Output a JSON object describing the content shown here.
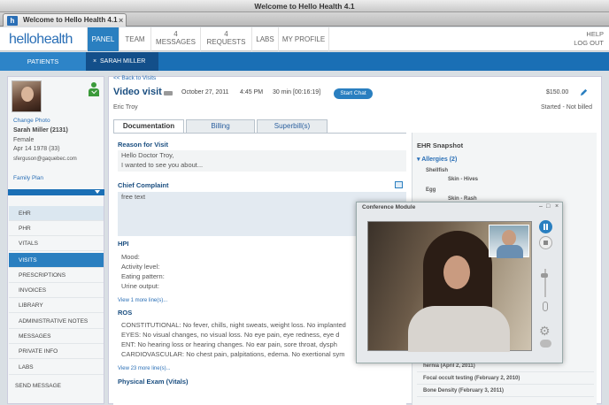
{
  "window": {
    "title": "Welcome to Hello Health 4.1",
    "tab_icon": "h",
    "tab_label": "Welcome to Hello Health 4.1",
    "tab_close": "×"
  },
  "header": {
    "logo": "hellohealth",
    "nav": [
      {
        "count": "",
        "label": "PANEL"
      },
      {
        "count": "",
        "label": "TEAM"
      },
      {
        "count": "4",
        "label": "MESSAGES"
      },
      {
        "count": "4",
        "label": "REQUESTS"
      },
      {
        "count": "",
        "label": "LABS"
      },
      {
        "count": "",
        "label": "MY PROFILE"
      }
    ],
    "help": "HELP",
    "logout": "LOG OUT"
  },
  "bluebar": {
    "patients": "PATIENTS",
    "patient_tab_close": "×",
    "patient_tab": "SARAH MILLER"
  },
  "sidebar": {
    "change_photo": "Change Photo",
    "name": "Sarah Miller (2131)",
    "gender": "Female",
    "dob": "Apr 14 1978 (33)",
    "email": "sferguson@gaquebec.com",
    "family_plan": "Family Plan",
    "menu": [
      "EHR",
      "PHR",
      "VITALS",
      "VISITS",
      "PRESCRIPTIONS",
      "INVOICES",
      "LIBRARY",
      "ADMINISTRATIVE NOTES",
      "MESSAGES",
      "PRIVATE INFO",
      "LABS"
    ],
    "send_message": "SEND MESSAGE"
  },
  "visit": {
    "back": "<< Back to Visits",
    "title": "Video visit",
    "date": "October 27, 2011",
    "time": "4:45 PM",
    "duration": "30 min [00:16:19]",
    "start_chat": "Start Chat",
    "price": "$150.00",
    "provider": "Eric Troy",
    "status": "Started - Not billed",
    "tabs": [
      "Documentation",
      "Billing",
      "Superbill(s)"
    ]
  },
  "documentation": {
    "reason_heading": "Reason for Visit",
    "reason_lines": [
      "Hello Doctor Troy,",
      "I wanted to see you about..."
    ],
    "complaint_heading": "Chief Complaint",
    "complaint_placeholder": "free text",
    "hpi_heading": "HPI",
    "hpi_lines": [
      "Mood:",
      "Activity level:",
      "Eating pattern:",
      "Urine output:"
    ],
    "hpi_more": "View 1 more line(s)...",
    "ros_heading": "ROS",
    "ros_lines": [
      "CONSTITUTIONAL: No fever, chills, night sweats, weight loss. No implanted",
      "EYES: No visual changes, no visual loss. No eye pain, eye redness, eye d",
      "ENT: No hearing loss or hearing changes. No ear pain, sore throat, dysph",
      "CARDIOVASCULAR: No chest pain, palpitations, edema. No exertional sym"
    ],
    "ros_more": "View 23 more line(s)...",
    "exam_heading": "Physical Exam (Vitals)"
  },
  "snapshot": {
    "title": "EHR Snapshot",
    "allergies": "Allergies (2)",
    "items": [
      {
        "name": "Shellfish",
        "detail": "Skin - Hives"
      },
      {
        "name": "Egg",
        "detail": "Skin - Rash"
      }
    ],
    "history": [
      "hernia (April 2, 2011)",
      "Focal occult testing (February 2, 2010)",
      "Bone Density (February 3, 2011)"
    ]
  },
  "conference": {
    "title": "Conference Module",
    "btn_min": "–",
    "btn_max": "□",
    "btn_close": "×",
    "gear_glyph": "⚙"
  },
  "icons": [
    "person-check-icon",
    "video-camera-icon",
    "pencil-icon",
    "chevron-down-icon",
    "pause-icon",
    "stop-icon",
    "mic-icon",
    "gear-icon",
    "chat-icon"
  ],
  "colors": {
    "accent": "#2a7fc0",
    "nav_blue": "#1a6fb5",
    "status_green": "#3a9a3a"
  }
}
